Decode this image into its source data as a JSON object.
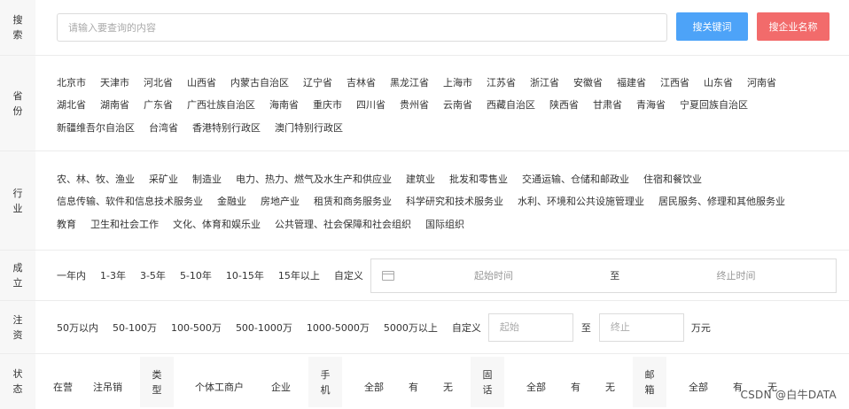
{
  "search": {
    "label": "搜索",
    "placeholder": "请输入要查询的内容",
    "btn_keyword": "搜关键词",
    "btn_company": "搜企业名称",
    "btn_keyword_color": "#4da3f8",
    "btn_company_color": "#f26b6b"
  },
  "province": {
    "label": "省份",
    "lines": [
      [
        "北京市",
        "天津市",
        "河北省",
        "山西省",
        "内蒙古自治区",
        "辽宁省",
        "吉林省",
        "黑龙江省",
        "上海市",
        "江苏省",
        "浙江省",
        "安徽省",
        "福建省",
        "江西省",
        "山东省",
        "河南省"
      ],
      [
        "湖北省",
        "湖南省",
        "广东省",
        "广西壮族自治区",
        "海南省",
        "重庆市",
        "四川省",
        "贵州省",
        "云南省",
        "西藏自治区",
        "陕西省",
        "甘肃省",
        "青海省",
        "宁夏回族自治区"
      ],
      [
        "新疆维吾尔自治区",
        "台湾省",
        "香港特别行政区",
        "澳门特别行政区"
      ]
    ]
  },
  "industry": {
    "label": "行业",
    "lines": [
      [
        "农、林、牧、渔业",
        "采矿业",
        "制造业",
        "电力、热力、燃气及水生产和供应业",
        "建筑业",
        "批发和零售业",
        "交通运输、仓储和邮政业",
        "住宿和餐饮业"
      ],
      [
        "信息传输、软件和信息技术服务业",
        "金融业",
        "房地产业",
        "租赁和商务服务业",
        "科学研究和技术服务业",
        "水利、环境和公共设施管理业",
        "居民服务、修理和其他服务业"
      ],
      [
        "教育",
        "卫生和社会工作",
        "文化、体育和娱乐业",
        "公共管理、社会保障和社会组织",
        "国际组织"
      ]
    ]
  },
  "established": {
    "label": "成立",
    "options": [
      "一年内",
      "1-3年",
      "3-5年",
      "5-10年",
      "10-15年",
      "15年以上",
      "自定义"
    ],
    "start_placeholder": "起始时间",
    "to": "至",
    "end_placeholder": "终止时间"
  },
  "capital": {
    "label": "注资",
    "options": [
      "50万以内",
      "50-100万",
      "100-500万",
      "500-1000万",
      "1000-5000万",
      "5000万以上",
      "自定义"
    ],
    "start_placeholder": "起始",
    "to": "至",
    "end_placeholder": "终止",
    "unit": "万元"
  },
  "status": {
    "label": "状态",
    "options": [
      "在营",
      "注吊销"
    ],
    "type_label": "类型",
    "type_options": [
      "个体工商户",
      "企业"
    ],
    "phone_label": "手机",
    "phone_options": [
      "全部",
      "有",
      "无"
    ],
    "landline_label": "固话",
    "landline_options": [
      "全部",
      "有",
      "无"
    ],
    "email_label": "邮箱",
    "email_options": [
      "全部",
      "有",
      "无"
    ]
  },
  "watermark": "CSDN @白牛DATA"
}
